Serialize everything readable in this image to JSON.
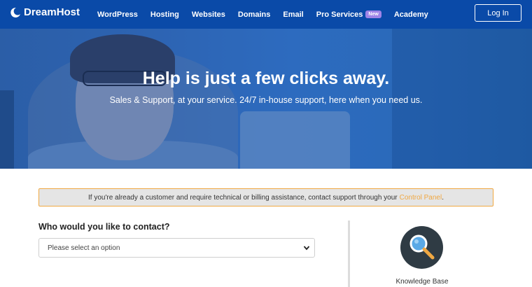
{
  "nav": {
    "brand": "DreamHost",
    "items": [
      {
        "label": "WordPress"
      },
      {
        "label": "Hosting"
      },
      {
        "label": "Websites"
      },
      {
        "label": "Domains"
      },
      {
        "label": "Email"
      },
      {
        "label": "Pro Services",
        "badge": "New"
      },
      {
        "label": "Academy"
      }
    ],
    "login_label": "Log In"
  },
  "hero": {
    "title": "Help is just a few clicks away.",
    "subtitle": "Sales & Support, at your service. 24/7 in-house support, here when you need us."
  },
  "notice": {
    "text": "If you're already a customer and require technical or billing assistance, contact support through your",
    "link_label": "Control Panel",
    "suffix": "."
  },
  "contact": {
    "question": "Who would you like to contact?",
    "select_placeholder": "Please select an option"
  },
  "resources": {
    "knowledge_base": {
      "label": "Knowledge Base",
      "icon": "magnifier-icon"
    }
  },
  "colors": {
    "nav_bg": "#0a4aa8",
    "accent_orange": "#f0a843",
    "badge_purple": "#9f84e8",
    "kb_circle": "#2f3b44"
  }
}
